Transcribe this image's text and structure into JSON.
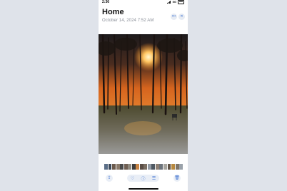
{
  "status_bar": {
    "time": "2:36",
    "network": "5G"
  },
  "header": {
    "title": "Home",
    "subtitle": "October 14, 2024  7:52 AM",
    "more_icon": "ellipsis-icon",
    "close_icon": "close-icon"
  },
  "photo": {
    "description_icon": "sunset-forest-photo"
  },
  "thumbnails": {
    "colors": [
      "#5b6f88",
      "#3e4a5a",
      "#6b5a4c",
      "#8a7a6a",
      "#4b4b4b",
      "#6f5f53",
      "#8f8a80",
      "#3d3d3d",
      "#c98545",
      "#5a4d45",
      "#7a6e62",
      "#939ba5",
      "#4f5963",
      "#8d7f74",
      "#6d747c",
      "#a6a49e",
      "#5f5246",
      "#b7893f",
      "#7d7468",
      "#9aa2aa"
    ]
  },
  "toolbar": {
    "share_icon": "share-icon",
    "favorite_icon": "heart-icon",
    "info_icon": "info-icon",
    "adjust_icon": "adjust-icon",
    "delete_icon": "trash-icon"
  },
  "colors": {
    "accent": "#3a6fd0",
    "subtitle": "#8a8f98"
  }
}
